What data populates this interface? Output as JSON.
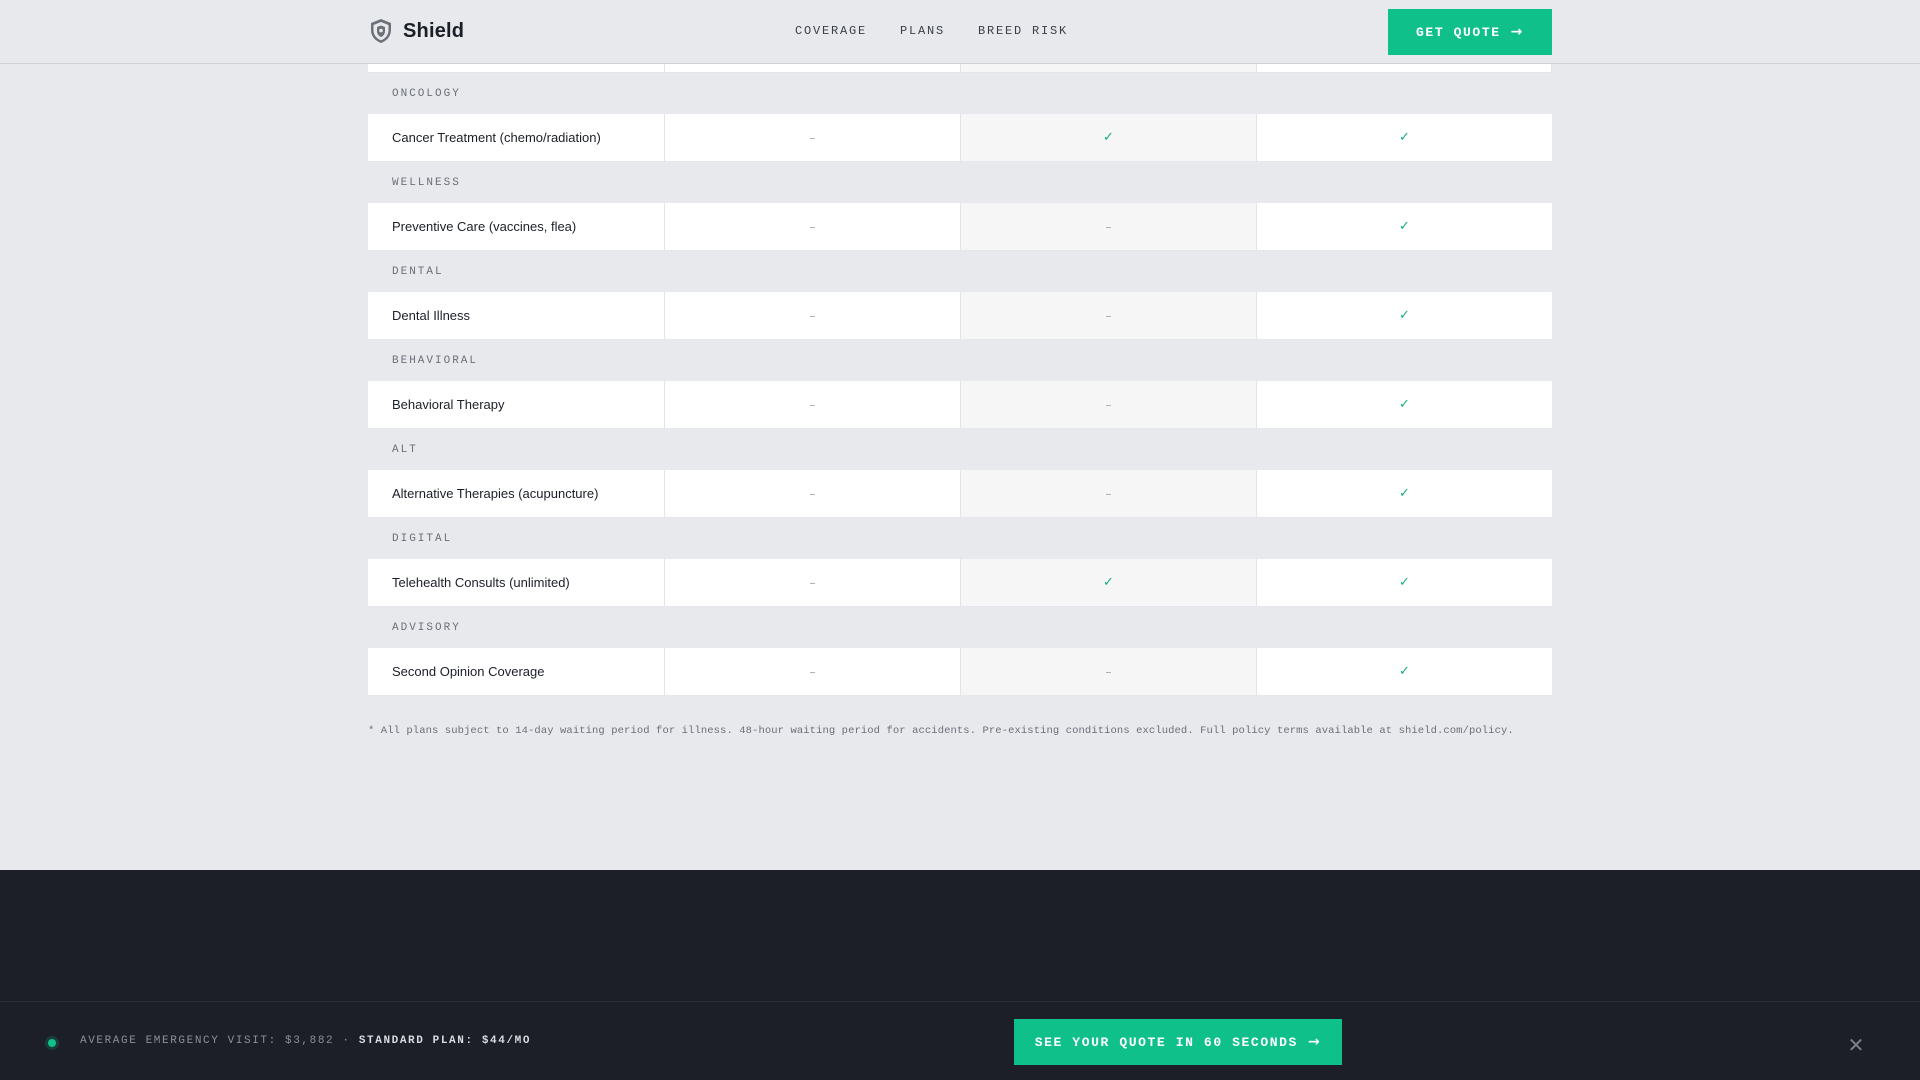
{
  "header": {
    "brand": "Shield",
    "nav": [
      "COVERAGE",
      "PLANS",
      "BREED RISK"
    ],
    "cta_label": "GET QUOTE"
  },
  "table": {
    "groups": [
      {
        "label": "ONCOLOGY",
        "feature": "Cancer Treatment (chemo/radiation)",
        "values": [
          "dash",
          "check",
          "check"
        ]
      },
      {
        "label": "WELLNESS",
        "feature": "Preventive Care (vaccines, flea)",
        "values": [
          "dash",
          "dash",
          "check"
        ]
      },
      {
        "label": "DENTAL",
        "feature": "Dental Illness",
        "values": [
          "dash",
          "dash",
          "check"
        ]
      },
      {
        "label": "BEHAVIORAL",
        "feature": "Behavioral Therapy",
        "values": [
          "dash",
          "dash",
          "check"
        ]
      },
      {
        "label": "ALT",
        "feature": "Alternative Therapies (acupuncture)",
        "values": [
          "dash",
          "dash",
          "check"
        ]
      },
      {
        "label": "DIGITAL",
        "feature": "Telehealth Consults (unlimited)",
        "values": [
          "dash",
          "check",
          "check"
        ]
      },
      {
        "label": "ADVISORY",
        "feature": "Second Opinion Coverage",
        "values": [
          "dash",
          "dash",
          "check"
        ]
      }
    ],
    "check_glyph": "✓",
    "dash_glyph": "–"
  },
  "footnote": "* All plans subject to 14-day waiting period for illness. 48-hour waiting period for accidents. Pre-existing conditions excluded. Full policy terms available at shield.com/policy.",
  "sticky_bar": {
    "ticker_label": "AVERAGE EMERGENCY VISIT: $3,882 ·",
    "ticker_highlight": "STANDARD PLAN: $44/MO",
    "cta_label": "SEE YOUR QUOTE IN 60 SECONDS",
    "close_glyph": "✕"
  },
  "colors": {
    "accent": "#10c08a",
    "check": "#10b07f",
    "page_bg": "#e8e9ec",
    "dark_bg": "#1c1f27"
  },
  "icons": {
    "brand": "shield-logo-icon",
    "cta_arrow": "arrow-right-icon",
    "close": "close-icon",
    "status": "status-dot-icon"
  }
}
